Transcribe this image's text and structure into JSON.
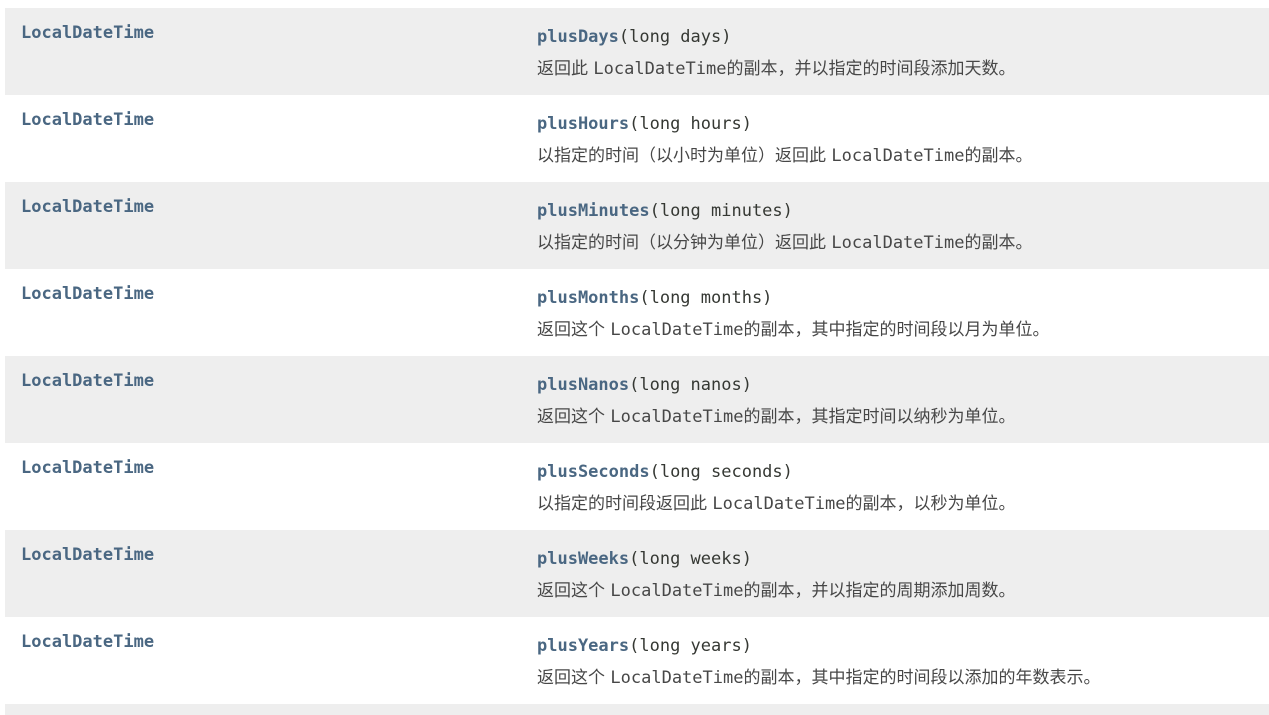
{
  "rows": [
    {
      "return_type": "LocalDateTime",
      "method_name": "plusDays",
      "params": "(long days)",
      "desc_before": "返回此 ",
      "desc_code": "LocalDateTime",
      "desc_after": "的副本，并以指定的时间段添加天数。"
    },
    {
      "return_type": "LocalDateTime",
      "method_name": "plusHours",
      "params": "(long hours)",
      "desc_before": "以指定的时间（以小时为单位）返回此 ",
      "desc_code": "LocalDateTime",
      "desc_after": "的副本。"
    },
    {
      "return_type": "LocalDateTime",
      "method_name": "plusMinutes",
      "params": "(long minutes)",
      "desc_before": "以指定的时间（以分钟为单位）返回此 ",
      "desc_code": "LocalDateTime",
      "desc_after": "的副本。"
    },
    {
      "return_type": "LocalDateTime",
      "method_name": "plusMonths",
      "params": "(long months)",
      "desc_before": "返回这个 ",
      "desc_code": "LocalDateTime",
      "desc_after": "的副本，其中指定的时间段以月为单位。"
    },
    {
      "return_type": "LocalDateTime",
      "method_name": "plusNanos",
      "params": "(long nanos)",
      "desc_before": "返回这个 ",
      "desc_code": "LocalDateTime",
      "desc_after": "的副本，其指定时间以纳秒为单位。"
    },
    {
      "return_type": "LocalDateTime",
      "method_name": "plusSeconds",
      "params": "(long seconds)",
      "desc_before": "以指定的时间段返回此 ",
      "desc_code": "LocalDateTime",
      "desc_after": "的副本，以秒为单位。"
    },
    {
      "return_type": "LocalDateTime",
      "method_name": "plusWeeks",
      "params": "(long weeks)",
      "desc_before": "返回这个 ",
      "desc_code": "LocalDateTime",
      "desc_after": "的副本，并以指定的周期添加周数。"
    },
    {
      "return_type": "LocalDateTime",
      "method_name": "plusYears",
      "params": "(long years)",
      "desc_before": "返回这个 ",
      "desc_code": "LocalDateTime",
      "desc_after": "的副本，其中指定的时间段以添加的年数表示。"
    }
  ]
}
